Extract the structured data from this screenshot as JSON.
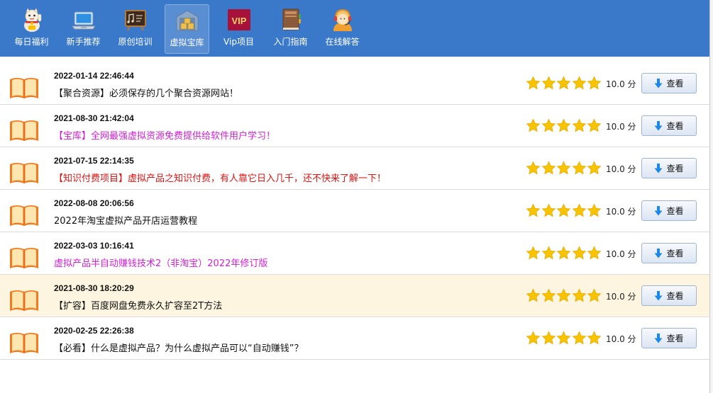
{
  "toolbar": {
    "items": [
      {
        "label": "每日福利",
        "icon": "lucky-cat-icon"
      },
      {
        "label": "新手推荐",
        "icon": "laptop-icon"
      },
      {
        "label": "原创培训",
        "icon": "chalkboard-icon"
      },
      {
        "label": "虚拟宝库",
        "icon": "warehouse-icon",
        "active": true
      },
      {
        "label": "Vip项目",
        "icon": "vip-icon"
      },
      {
        "label": "入门指南",
        "icon": "book-guide-icon"
      },
      {
        "label": "在线解答",
        "icon": "support-agent-icon"
      }
    ],
    "vip_text": "VIP",
    "bg_color": "#3a78c9"
  },
  "list": {
    "view_label": "查看",
    "items": [
      {
        "date": "2022-01-14 22:46:44",
        "title": "【聚合资源】必须保存的几个聚合资源网站！",
        "title_color": "#111111",
        "stars": 5,
        "score": "10.0 分",
        "highlighted": false
      },
      {
        "date": "2021-08-30 21:42:04",
        "title": "【宝库】全网最强虚拟资源免费提供给软件用户学习！",
        "title_color": "#d21fd6",
        "stars": 5,
        "score": "10.0 分",
        "highlighted": false
      },
      {
        "date": "2021-07-15 22:14:35",
        "title": "【知识付费项目】虚拟产品之知识付费，有人靠它日入几千，还不快来了解一下！",
        "title_color": "#e01212",
        "stars": 5,
        "score": "10.0 分",
        "highlighted": false
      },
      {
        "date": "2022-08-08 20:06:56",
        "title": "2022年淘宝虚拟产品开店运营教程",
        "title_color": "#111111",
        "stars": 5,
        "score": "10.0 分",
        "highlighted": false
      },
      {
        "date": "2022-03-03 10:16:41",
        "title": "虚拟产品半自动赚钱技术2（非淘宝）2022年修订版",
        "title_color": "#d21fd6",
        "stars": 5,
        "score": "10.0 分",
        "highlighted": false
      },
      {
        "date": "2021-08-30 18:20:29",
        "title": "【扩容】百度网盘免费永久扩容至2T方法",
        "title_color": "#111111",
        "stars": 5,
        "score": "10.0 分",
        "highlighted": true
      },
      {
        "date": "2020-02-25 22:26:38",
        "title": "【必看】什么是虚拟产品？为什么虚拟产品可以“自动赚钱”？",
        "title_color": "#111111",
        "stars": 5,
        "score": "10.0 分",
        "highlighted": false
      }
    ]
  }
}
